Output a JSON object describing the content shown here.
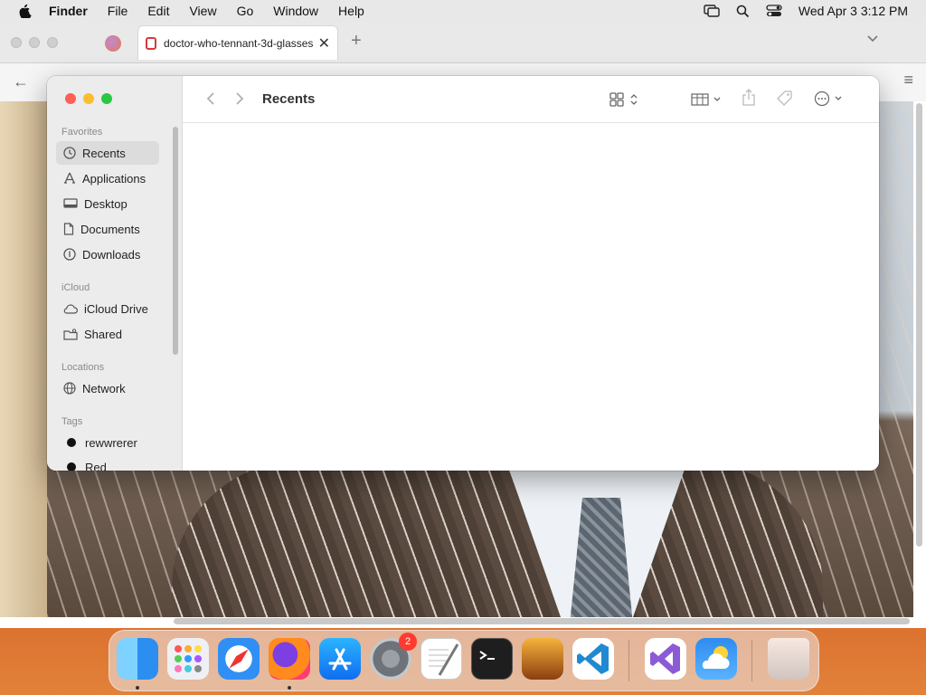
{
  "menubar": {
    "app_name": "Finder",
    "menus": [
      "File",
      "Edit",
      "View",
      "Go",
      "Window",
      "Help"
    ],
    "datetime": "Wed Apr 3  3:12 PM"
  },
  "browser": {
    "tab_title": "doctor-who-tennant-3d-glasses"
  },
  "finder": {
    "title": "Recents",
    "sections": {
      "favorites": "Favorites",
      "icloud": "iCloud",
      "locations": "Locations",
      "tags": "Tags"
    },
    "favorites": [
      "Recents",
      "Applications",
      "Desktop",
      "Documents",
      "Downloads"
    ],
    "icloud_items": [
      "iCloud Drive",
      "Shared"
    ],
    "location_items": [
      "Network"
    ],
    "tag_items": [
      "rewwrerer",
      "Red"
    ]
  },
  "dock": {
    "badge_count": "2",
    "apps": [
      "finder-icon",
      "launchpad-icon",
      "safari-icon",
      "firefox-icon",
      "app-store-icon",
      "system-settings-icon",
      "textedit-icon",
      "terminal-icon",
      "garageband-icon",
      "vscode-icon",
      "visual-studio-icon",
      "weather-icon",
      "trash-icon"
    ]
  },
  "colors": {
    "close": "#fe5f57",
    "minimize": "#febc2e",
    "zoom": "#28c840",
    "sidebar_bg": "#ececec"
  }
}
